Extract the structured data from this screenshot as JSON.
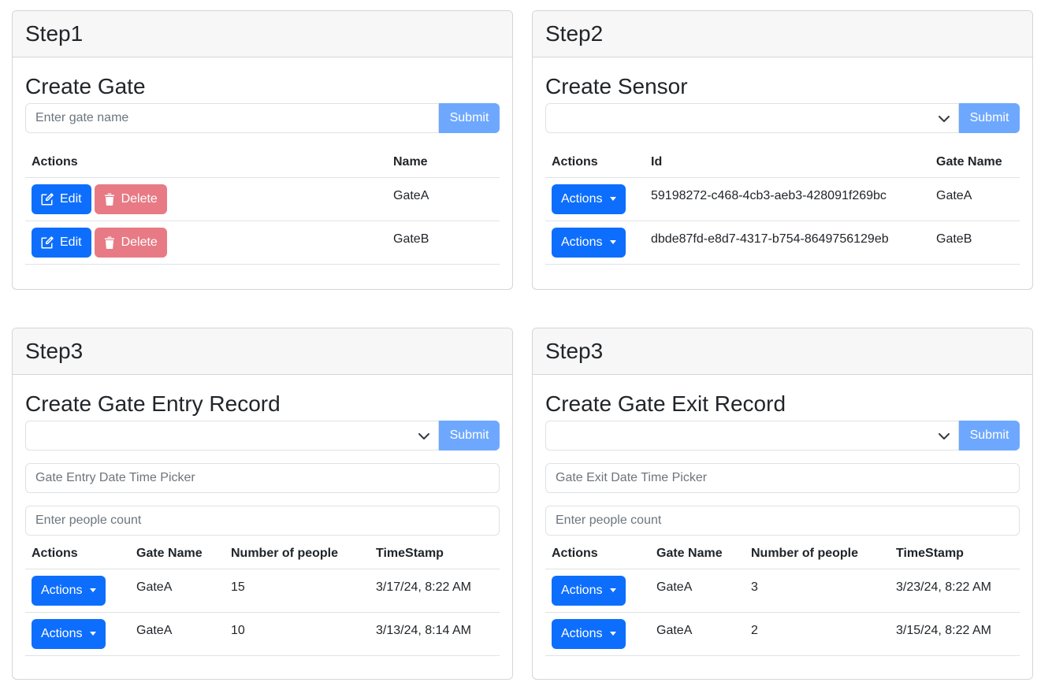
{
  "gate_card": {
    "header": "Step1",
    "title": "Create Gate",
    "input_placeholder": "Enter gate name",
    "submit_label": "Submit",
    "columns": [
      "Actions",
      "Name"
    ],
    "edit_label": "Edit",
    "delete_label": "Delete",
    "rows": [
      {
        "name": "GateA"
      },
      {
        "name": "GateB"
      }
    ]
  },
  "sensor_card": {
    "header": "Step2",
    "title": "Create Sensor",
    "select_value": "",
    "submit_label": "Submit",
    "columns": [
      "Actions",
      "Id",
      "Gate Name"
    ],
    "actions_label": "Actions",
    "rows": [
      {
        "id": "59198272-c468-4cb3-aeb3-428091f269bc",
        "gate_name": "GateA"
      },
      {
        "id": "dbde87fd-e8d7-4317-b754-8649756129eb",
        "gate_name": "GateB"
      }
    ]
  },
  "entry_card": {
    "header": "Step3",
    "title": "Create Gate Entry Record",
    "select_value": "",
    "submit_label": "Submit",
    "datetime_placeholder": "Gate Entry Date Time Picker",
    "count_placeholder": "Enter people count",
    "columns": [
      "Actions",
      "Gate Name",
      "Number of people",
      "TimeStamp"
    ],
    "actions_label": "Actions",
    "rows": [
      {
        "gate_name": "GateA",
        "people": "15",
        "timestamp": "3/17/24, 8:22 AM"
      },
      {
        "gate_name": "GateA",
        "people": "10",
        "timestamp": "3/13/24, 8:14 AM"
      }
    ]
  },
  "exit_card": {
    "header": "Step3",
    "title": "Create Gate Exit Record",
    "select_value": "",
    "submit_label": "Submit",
    "datetime_placeholder": "Gate Exit Date Time Picker",
    "count_placeholder": "Enter people count",
    "columns": [
      "Actions",
      "Gate Name",
      "Number of people",
      "TimeStamp"
    ],
    "actions_label": "Actions",
    "rows": [
      {
        "gate_name": "GateA",
        "people": "3",
        "timestamp": "3/23/24, 8:22 AM"
      },
      {
        "gate_name": "GateA",
        "people": "2",
        "timestamp": "3/15/24, 8:22 AM"
      }
    ]
  },
  "icons": {
    "edit": "pencil-square-icon",
    "delete": "trash-icon",
    "dropdown": "chevron-down-icon",
    "caret": "caret-down-icon"
  },
  "colors": {
    "primary": "#0d6efd",
    "submit_disabled": "#6ea8fe",
    "danger_disabled": "#e77a84",
    "header_bg": "#f7f7f7"
  }
}
